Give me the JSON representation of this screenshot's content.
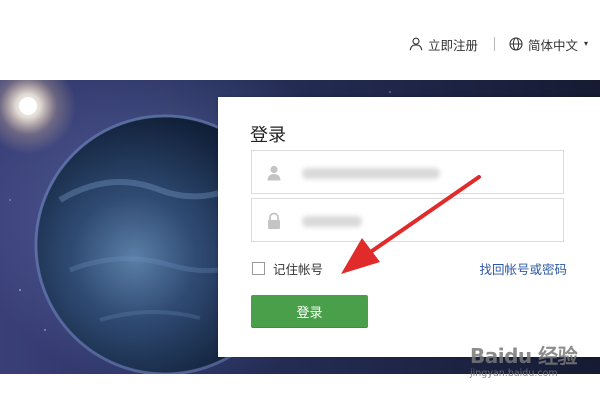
{
  "header": {
    "register_label": "立即注册",
    "language_label": "简体中文",
    "language_caret": "▾",
    "icons": [
      "user-icon",
      "globe-icon"
    ]
  },
  "login": {
    "title": "登录",
    "username_value": "",
    "password_value": "",
    "remember_label": "记住帐号",
    "remember_checked": false,
    "forgot_label": "找回帐号或密码",
    "submit_label": "登录",
    "icons": [
      "user-icon",
      "lock-icon"
    ]
  },
  "colors": {
    "accent_green": "#4aa04a",
    "link_blue": "#2c5aa0",
    "arrow_red": "#e12a2a"
  },
  "watermark": {
    "logo_text": "Baidu 经验",
    "url_text": "jingyan.baidu.com"
  }
}
